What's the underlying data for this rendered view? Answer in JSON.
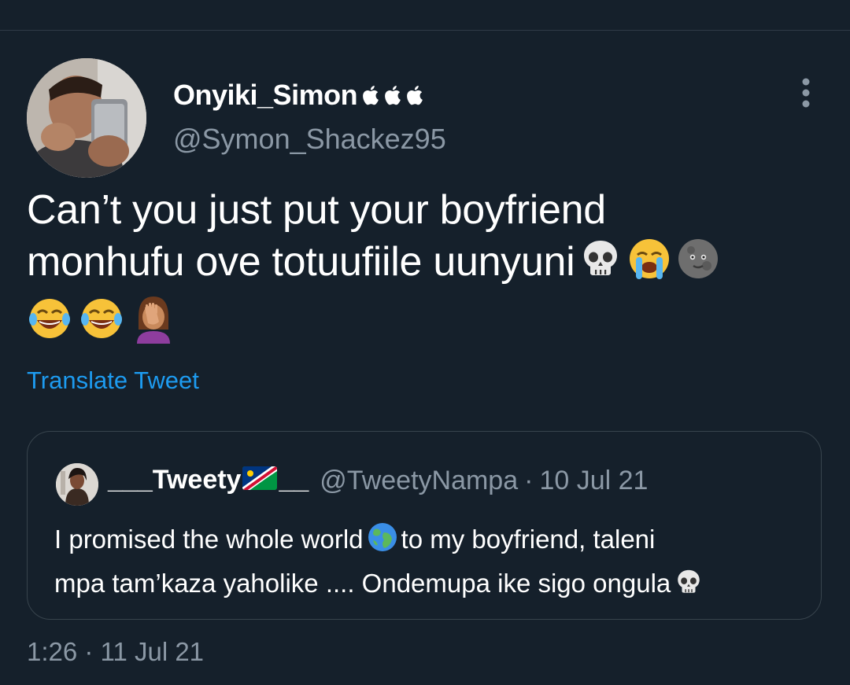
{
  "tweet": {
    "author": {
      "display_name": "Onyiki_Simon",
      "badge_icons": [
        "apple-icon",
        "apple-icon",
        "apple-icon"
      ],
      "handle": "@Symon_Shackez95"
    },
    "text_line1": "Can’t you just put your boyfriend",
    "text_line2": "monhufu ove totuufiile uunyuni",
    "emojis": [
      "skull-emoji",
      "loudly-crying-emoji",
      "new-moon-face-emoji",
      "tears-of-joy-emoji",
      "tears-of-joy-emoji",
      "woman-facepalming-emoji"
    ],
    "translate_label": "Translate Tweet",
    "timestamp": "1:26 · 11 Jul 21"
  },
  "quoted_tweet": {
    "name_prefix": "___Tweety",
    "name_suffix": "__",
    "flag_icon": "namibia-flag-icon",
    "handle": "@TweetyNampa",
    "separator": "·",
    "date": "10 Jul 21",
    "text_part1": "I promised the whole world",
    "text_part2": "to my boyfriend, taleni",
    "text_part3": "mpa tam’kaza yaholike .... Ondemupa ike sigo ongula"
  },
  "colors": {
    "background": "#15202b",
    "text_primary": "#ffffff",
    "text_secondary": "#8b98a5",
    "link": "#1d9bf0",
    "border": "#38444d"
  }
}
